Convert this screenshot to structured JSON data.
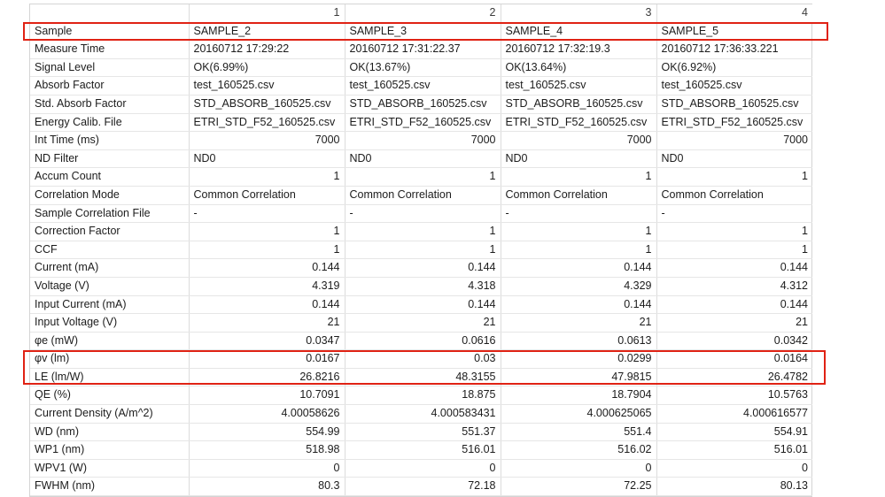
{
  "table": {
    "column_headers": [
      "",
      "1",
      "2",
      "3",
      "4"
    ],
    "rows": [
      {
        "label": "Sample",
        "align": "text",
        "values": [
          "SAMPLE_2",
          "SAMPLE_3",
          "SAMPLE_4",
          "SAMPLE_5"
        ]
      },
      {
        "label": "Measure Time",
        "align": "text",
        "values": [
          "20160712 17:29:22",
          "20160712 17:31:22.37",
          "20160712 17:32:19.3",
          "20160712 17:36:33.221"
        ]
      },
      {
        "label": "Signal Level",
        "align": "text",
        "values": [
          "OK(6.99%)",
          "OK(13.67%)",
          "OK(13.64%)",
          "OK(6.92%)"
        ]
      },
      {
        "label": "Absorb Factor",
        "align": "text",
        "values": [
          "test_160525.csv",
          "test_160525.csv",
          "test_160525.csv",
          "test_160525.csv"
        ]
      },
      {
        "label": "Std. Absorb Factor",
        "align": "text",
        "values": [
          "STD_ABSORB_160525.csv",
          "STD_ABSORB_160525.csv",
          "STD_ABSORB_160525.csv",
          "STD_ABSORB_160525.csv"
        ]
      },
      {
        "label": "Energy Calib. File",
        "align": "text",
        "values": [
          "ETRI_STD_F52_160525.csv",
          "ETRI_STD_F52_160525.csv",
          "ETRI_STD_F52_160525.csv",
          "ETRI_STD_F52_160525.csv"
        ]
      },
      {
        "label": "Int Time (ms)",
        "align": "num",
        "values": [
          "7000",
          "7000",
          "7000",
          "7000"
        ]
      },
      {
        "label": "ND Filter",
        "align": "text",
        "values": [
          "ND0",
          "ND0",
          "ND0",
          "ND0"
        ]
      },
      {
        "label": "Accum Count",
        "align": "num",
        "values": [
          "1",
          "1",
          "1",
          "1"
        ]
      },
      {
        "label": "Correlation Mode",
        "align": "text",
        "values": [
          "Common Correlation",
          "Common Correlation",
          "Common Correlation",
          "Common Correlation"
        ]
      },
      {
        "label": "Sample Correlation File",
        "align": "text",
        "values": [
          "-",
          "-",
          "-",
          "-"
        ]
      },
      {
        "label": "Correction Factor",
        "align": "num",
        "values": [
          "1",
          "1",
          "1",
          "1"
        ]
      },
      {
        "label": "CCF",
        "align": "num",
        "values": [
          "1",
          "1",
          "1",
          "1"
        ]
      },
      {
        "label": "Current (mA)",
        "align": "num",
        "values": [
          "0.144",
          "0.144",
          "0.144",
          "0.144"
        ]
      },
      {
        "label": "Voltage (V)",
        "align": "num",
        "values": [
          "4.319",
          "4.318",
          "4.329",
          "4.312"
        ]
      },
      {
        "label": "Input Current (mA)",
        "align": "num",
        "values": [
          "0.144",
          "0.144",
          "0.144",
          "0.144"
        ]
      },
      {
        "label": "Input Voltage (V)",
        "align": "num",
        "values": [
          "21",
          "21",
          "21",
          "21"
        ]
      },
      {
        "label": "φe (mW)",
        "align": "num",
        "values": [
          "0.0347",
          "0.0616",
          "0.0613",
          "0.0342"
        ]
      },
      {
        "label": "φv (lm)",
        "align": "num",
        "values": [
          "0.0167",
          "0.03",
          "0.0299",
          "0.0164"
        ]
      },
      {
        "label": "LE (lm/W)",
        "align": "num",
        "values": [
          "26.8216",
          "48.3155",
          "47.9815",
          "26.4782"
        ]
      },
      {
        "label": "QE (%)",
        "align": "num",
        "values": [
          "10.7091",
          "18.875",
          "18.7904",
          "10.5763"
        ]
      },
      {
        "label": "Current Density (A/m^2)",
        "align": "num",
        "values": [
          "4.00058626",
          "4.000583431",
          "4.000625065",
          "4.000616577"
        ]
      },
      {
        "label": "WD (nm)",
        "align": "num",
        "values": [
          "554.99",
          "551.37",
          "551.4",
          "554.91"
        ]
      },
      {
        "label": "WP1 (nm)",
        "align": "num",
        "values": [
          "518.98",
          "516.01",
          "516.02",
          "516.01"
        ]
      },
      {
        "label": "WPV1 (W)",
        "align": "num",
        "values": [
          "0",
          "0",
          "0",
          "0"
        ]
      },
      {
        "label": "FWHM (nm)",
        "align": "num",
        "values": [
          "80.3",
          "72.18",
          "72.25",
          "80.13"
        ]
      }
    ]
  },
  "annotations": {
    "color": "#e02214",
    "boxes": [
      {
        "name": "sample-row-highlight",
        "target_row": "Sample"
      },
      {
        "name": "le-qe-rows-highlight",
        "target_rows": [
          "LE (lm/W)",
          "QE (%)"
        ]
      }
    ]
  }
}
